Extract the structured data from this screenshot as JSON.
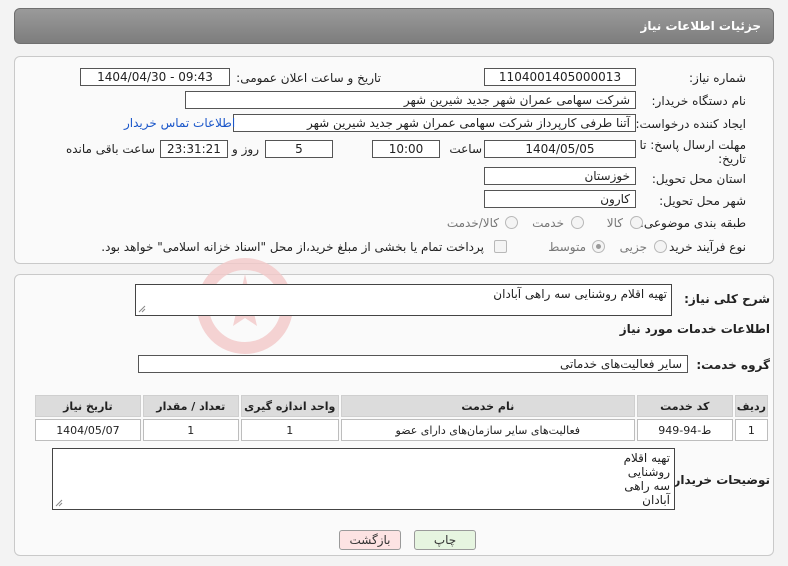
{
  "header": {
    "title": "جزئیات اطلاعات نیاز"
  },
  "form": {
    "need_number_label": "شماره نیاز:",
    "need_number": "1104001405000013",
    "announce_label": "تاریخ و ساعت اعلان عمومی:",
    "announce_value": "1404/04/30 - 09:43",
    "buyer_org_label": "نام دستگاه خریدار:",
    "buyer_org": "شرکت سهامی عمران شهر جدید شیرین شهر",
    "creator_label": "ایجاد کننده درخواست:",
    "creator": "آتنا طرفی کارپرداز شرکت سهامی عمران شهر جدید شیرین شهر",
    "contact_link": "اطلاعات تماس خریدار",
    "deadline_label_1": "مهلت ارسال پاسخ: تا",
    "deadline_label_2": "تاریخ:",
    "deadline_date": "1404/05/05",
    "time_label": "ساعت",
    "deadline_time": "10:00",
    "days_value": "5",
    "days_label": "روز و",
    "remaining_value": "23:31:21",
    "remaining_label": "ساعت باقی مانده",
    "province_label": "استان محل تحویل:",
    "province": "خوزستان",
    "city_label": "شهر محل تحویل:",
    "city": "کارون",
    "category_label": "طبقه بندی موضوعی:",
    "category_options": [
      "کالا",
      "خدمت",
      "کالا/خدمت"
    ],
    "process_label": "نوع فرآیند خرید :",
    "process_options": [
      "جزیی",
      "متوسط"
    ],
    "payment_note": "پرداخت تمام یا بخشی از مبلغ خرید،از محل \"اسناد خزانه اسلامی\" خواهد بود."
  },
  "need": {
    "summary_label": "شرح کلی نیاز:",
    "summary": "تهیه اقلام روشنایی سه راهی آبادان",
    "services_title": "اطلاعات خدمات مورد نیاز",
    "group_label": "گروه خدمت:",
    "group": "سایر فعالیت‌های خدماتی"
  },
  "table": {
    "headers": [
      "ردیف",
      "کد خدمت",
      "نام خدمت",
      "واحد اندازه گیری",
      "تعداد / مقدار",
      "تاریخ نیاز"
    ],
    "rows": [
      [
        "1",
        "ط-94-949",
        "فعالیت‌های سایر سازمان‌های دارای عضو",
        "1",
        "1",
        "1404/05/07"
      ]
    ]
  },
  "buyer_notes": {
    "label": "توضیحات خریدار:",
    "lines": [
      "تهیه اقلام",
      "روشنایی",
      "سه راهی",
      "آبادان"
    ]
  },
  "buttons": {
    "print": "چاپ",
    "back": "بازگشت"
  },
  "colors": {
    "header_bg": "#8a8a8a",
    "link": "#1a56c9",
    "back_btn": "#fde3e3",
    "print_btn": "#e6f5e0"
  }
}
